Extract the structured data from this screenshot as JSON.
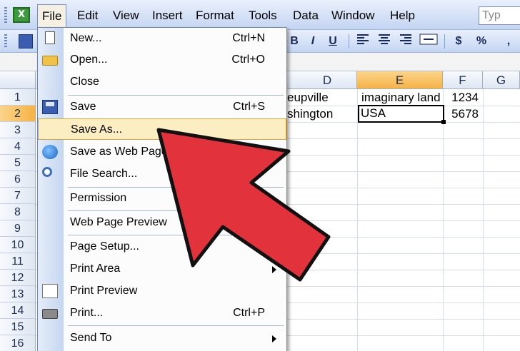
{
  "menubar": {
    "items": [
      "File",
      "Edit",
      "View",
      "Insert",
      "Format",
      "Tools",
      "Data",
      "Window",
      "Help"
    ],
    "active": "File",
    "help_placeholder": "Typ"
  },
  "toolbar": {
    "bold": "B",
    "italic": "I",
    "underline": "U",
    "currency": "$",
    "percent": "%",
    "comma": ","
  },
  "columns": [
    "D",
    "E",
    "F",
    "G"
  ],
  "selected_column": "E",
  "rows": [
    "1",
    "2",
    "3",
    "4",
    "5",
    "6",
    "7",
    "8",
    "9",
    "10",
    "11",
    "12",
    "13",
    "14",
    "15",
    "16"
  ],
  "selected_row": "2",
  "cells": {
    "D1": "eupville",
    "E1": "imaginary land",
    "F1": "1234",
    "D2": "shington",
    "E2": "USA",
    "F2": "5678"
  },
  "file_menu": {
    "items": [
      {
        "label": "New...",
        "shortcut": "Ctrl+N",
        "icon": "new-document-icon"
      },
      {
        "label": "Open...",
        "shortcut": "Ctrl+O",
        "icon": "open-folder-icon"
      },
      {
        "label": "Close",
        "shortcut": "",
        "icon": ""
      },
      {
        "label": "Save",
        "shortcut": "Ctrl+S",
        "icon": "save-floppy-icon"
      },
      {
        "label": "Save As...",
        "shortcut": "",
        "icon": ""
      },
      {
        "label": "Save as Web Page...",
        "shortcut": "",
        "icon": "web-page-icon"
      },
      {
        "label": "File Search...",
        "shortcut": "",
        "icon": "file-search-icon"
      },
      {
        "label": "Permission",
        "shortcut": "",
        "icon": ""
      },
      {
        "label": "Web Page Preview",
        "shortcut": "",
        "icon": ""
      },
      {
        "label": "Page Setup...",
        "shortcut": "",
        "icon": ""
      },
      {
        "label": "Print Area",
        "shortcut": "",
        "icon": "",
        "submenu": true
      },
      {
        "label": "Print Preview",
        "shortcut": "",
        "icon": "print-preview-icon"
      },
      {
        "label": "Print...",
        "shortcut": "Ctrl+P",
        "icon": "printer-icon"
      },
      {
        "label": "Send To",
        "shortcut": "",
        "icon": "",
        "submenu": true
      }
    ],
    "highlighted": "Save As..."
  },
  "colors": {
    "highlight": "#fbeec3",
    "arrow_fill": "#e2323c",
    "arrow_stroke": "#111111"
  }
}
